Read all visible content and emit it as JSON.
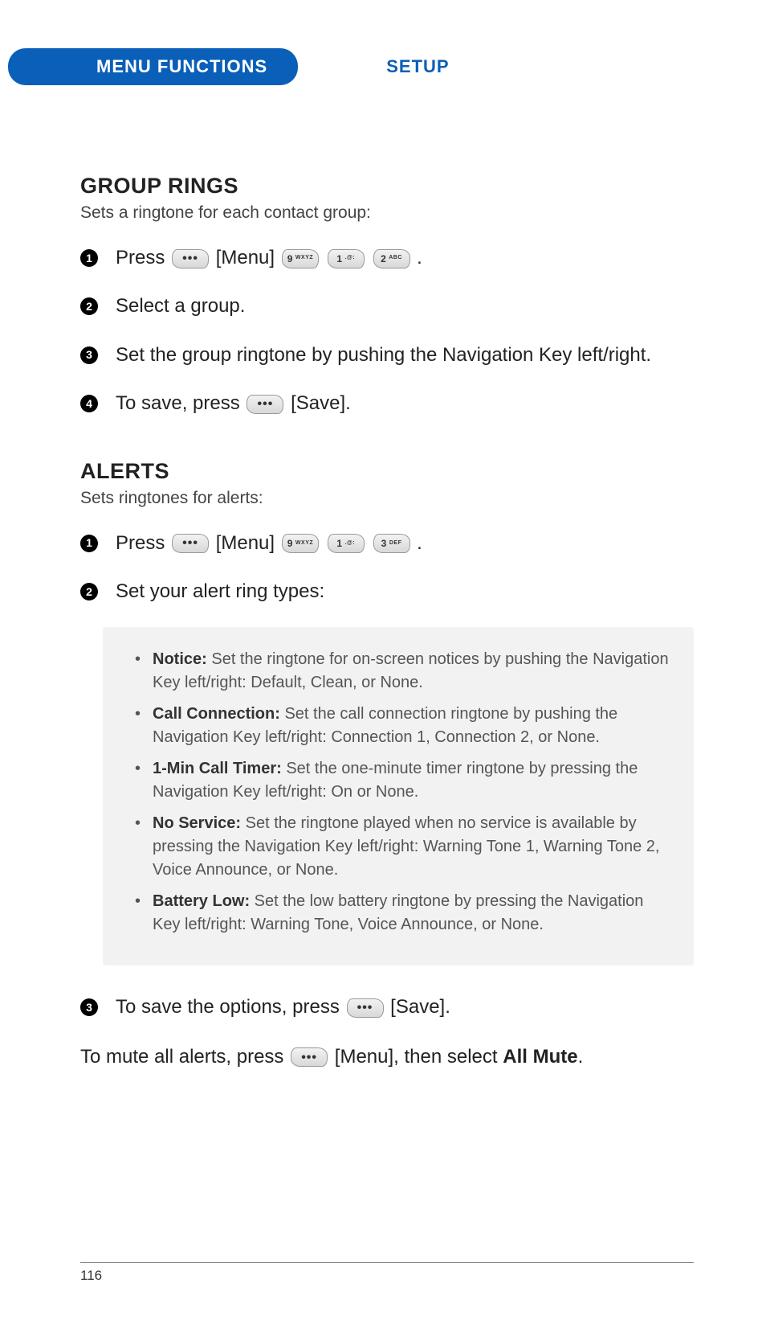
{
  "header": {
    "menu_tab": "MENU FUNCTIONS",
    "setup": "SETUP"
  },
  "section1": {
    "heading": "GROUP RINGS",
    "sub": "Sets a ringtone for each contact group:",
    "steps": [
      {
        "marker": "1",
        "pre": "Press ",
        "menu_label": "[Menu]",
        "keys": [
          "9 WXYZ",
          "1 .@:",
          "2 ABC"
        ],
        "tail": " ."
      },
      {
        "marker": "2",
        "text": "Select a group."
      },
      {
        "marker": "3",
        "text": "Set the group ringtone by pushing the Navigation Key left/right."
      },
      {
        "marker": "4",
        "pre": "To save, press ",
        "save_label": "[Save]."
      }
    ]
  },
  "section2": {
    "heading": "ALERTS",
    "sub": "Sets ringtones for alerts:",
    "steps1": [
      {
        "marker": "1",
        "pre": "Press ",
        "menu_label": "[Menu]",
        "keys": [
          "9 WXYZ",
          "1 .@:",
          "3 DEF"
        ],
        "tail": " ."
      },
      {
        "marker": "2",
        "text": "Set your alert ring types:"
      }
    ],
    "box": [
      {
        "bold": "Notice:",
        "text": " Set the ringtone for on-screen notices by pushing the Navigation Key left/right: Default, Clean, or None."
      },
      {
        "bold": "Call Connection:",
        "text": " Set the call connection ringtone by pushing the Navigation Key left/right: Connection 1, Connection 2, or None."
      },
      {
        "bold": "1-Min Call Timer:",
        "text": " Set the one-minute timer ringtone by pressing the Navigation Key left/right: On or None."
      },
      {
        "bold": "No Service:",
        "text": " Set the ringtone played when no service is available by pressing the Navigation Key left/right: Warning Tone 1, Warning Tone 2, Voice Announce, or None."
      },
      {
        "bold": "Battery Low:",
        "text": " Set the low battery ringtone by pressing the Navigation Key left/right: Warning Tone, Voice Announce, or None."
      }
    ],
    "step3": {
      "marker": "3",
      "pre": "To save the options, press ",
      "save_label": " [Save]."
    },
    "mute_pre": "To mute all alerts, press ",
    "mute_menu": " [Menu], then select ",
    "mute_bold": "All Mute",
    "mute_tail": "."
  },
  "keys": {
    "menu_dots": "•••",
    "save_dots": "•••"
  },
  "page_number": "116"
}
